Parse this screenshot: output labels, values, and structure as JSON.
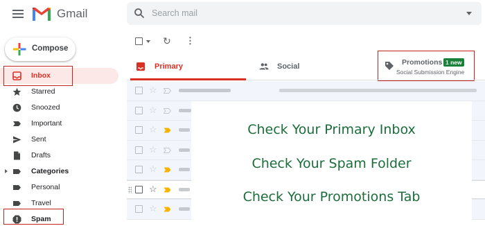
{
  "header": {
    "app_name": "Gmail",
    "search_placeholder": "Search mail",
    "icons": [
      "menu-icon",
      "gmail-logo",
      "search-icon",
      "chevron-down-icon"
    ]
  },
  "sidebar": {
    "compose_label": "Compose",
    "items": [
      {
        "label": "Inbox",
        "icon": "inbox-icon"
      },
      {
        "label": "Starred",
        "icon": "star-icon"
      },
      {
        "label": "Snoozed",
        "icon": "clock-icon"
      },
      {
        "label": "Important",
        "icon": "label-important-icon"
      },
      {
        "label": "Sent",
        "icon": "send-icon"
      },
      {
        "label": "Drafts",
        "icon": "draft-icon"
      },
      {
        "label": "Categories",
        "icon": "label-icon"
      },
      {
        "label": "Personal",
        "icon": "label-icon"
      },
      {
        "label": "Travel",
        "icon": "label-icon"
      },
      {
        "label": "Spam",
        "icon": "report-icon"
      }
    ]
  },
  "toolbar": {
    "icons": [
      "select-checkbox",
      "select-caret-icon",
      "refresh-icon",
      "more-vert-icon"
    ]
  },
  "tabs": {
    "primary": {
      "label": "Primary"
    },
    "social": {
      "label": "Social"
    },
    "promotions": {
      "label": "Promotions",
      "badge": "1 new",
      "subtitle": "Social Submission Engine"
    }
  },
  "overlay": {
    "line1": "Check Your Primary Inbox",
    "line2": "Check Your Spam Folder",
    "line3": "Check Your Promotions Tab"
  },
  "colors": {
    "accent_red": "#d93025",
    "highlight_box": "#c5221f",
    "badge_green": "#188038",
    "overlay_text": "#1b6d3a",
    "active_nav_bg": "#fce8e6"
  }
}
